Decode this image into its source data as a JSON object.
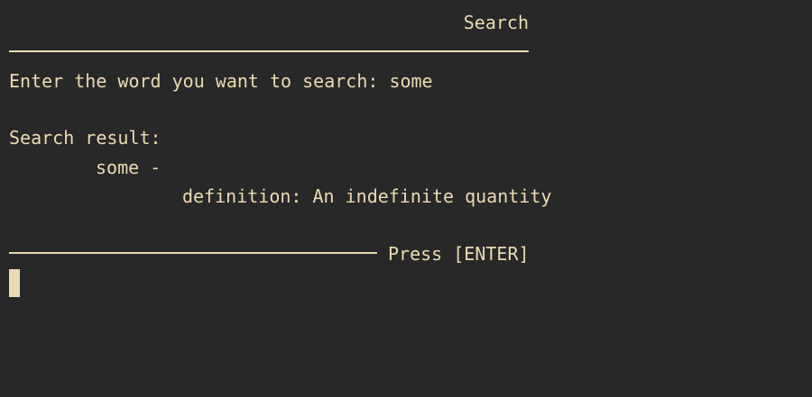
{
  "header": {
    "title": "Search"
  },
  "prompt": {
    "label": "Enter the word you want to search: ",
    "input_value": "some"
  },
  "result": {
    "heading": "Search result:",
    "word_line": "some -",
    "definition_line": "definition: An indefinite quantity"
  },
  "footer": {
    "press_label": "Press [ENTER]"
  },
  "colors": {
    "background": "#282828",
    "foreground": "#ebdbb2"
  },
  "icons": {
    "cursor": "block-cursor-icon"
  }
}
